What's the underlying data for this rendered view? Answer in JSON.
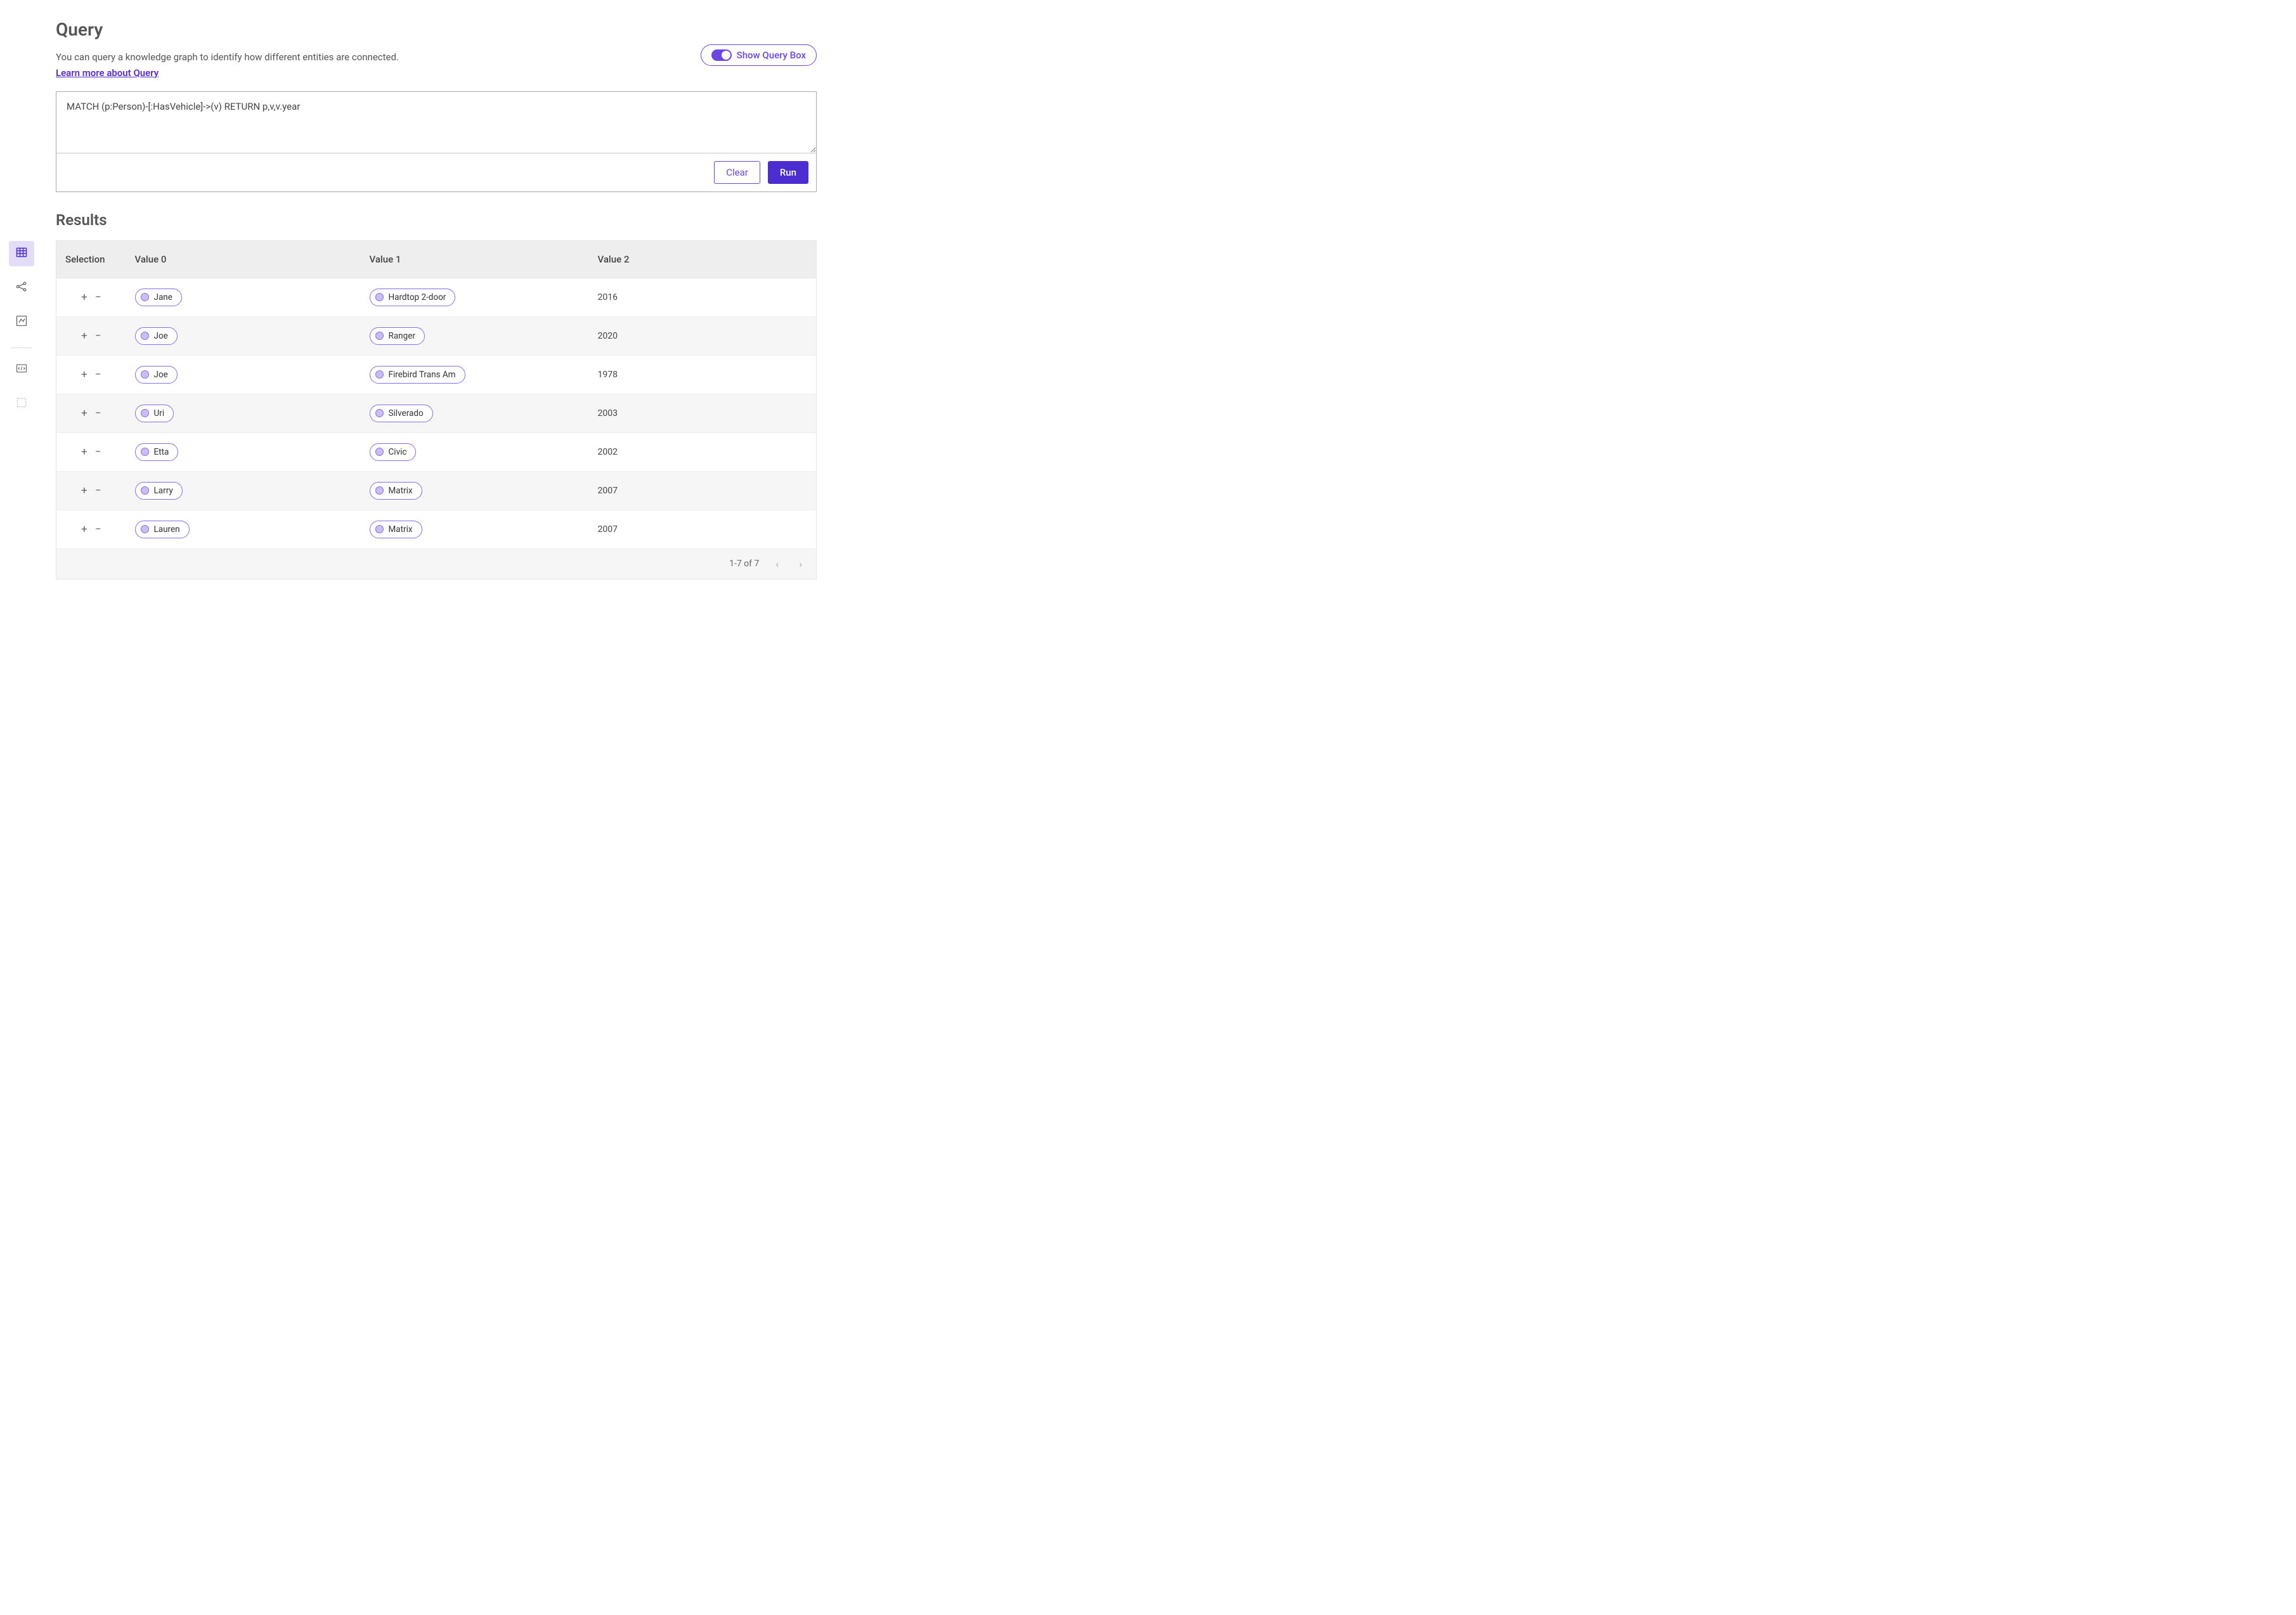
{
  "header": {
    "title": "Query",
    "description": "You can query a knowledge graph to identify how different entities are connected.",
    "learn_link": "Learn more about Query",
    "toggle_label": "Show Query Box"
  },
  "query": {
    "value": "MATCH (p:Person)-[:HasVehicle]->(v) RETURN p,v,v.year",
    "clear_label": "Clear",
    "run_label": "Run"
  },
  "results": {
    "title": "Results",
    "columns": {
      "selection": "Selection",
      "v0": "Value 0",
      "v1": "Value 1",
      "v2": "Value 2"
    },
    "rows": [
      {
        "v0": "Jane",
        "v1": "Hardtop 2-door",
        "v2": "2016"
      },
      {
        "v0": "Joe",
        "v1": "Ranger",
        "v2": "2020"
      },
      {
        "v0": "Joe",
        "v1": "Firebird Trans Am",
        "v2": "1978"
      },
      {
        "v0": "Uri",
        "v1": "Silverado",
        "v2": "2003"
      },
      {
        "v0": "Etta",
        "v1": "Civic",
        "v2": "2002"
      },
      {
        "v0": "Larry",
        "v1": "Matrix",
        "v2": "2007"
      },
      {
        "v0": "Lauren",
        "v1": "Matrix",
        "v2": "2007"
      }
    ],
    "pagination": "1-7 of 7"
  },
  "sidebar": {
    "items": [
      {
        "name": "table-view-icon",
        "active": true
      },
      {
        "name": "graph-view-icon",
        "active": false
      },
      {
        "name": "chart-view-icon",
        "active": false
      },
      {
        "name": "code-view-icon",
        "active": false
      },
      {
        "name": "select-view-icon",
        "active": false
      }
    ]
  }
}
